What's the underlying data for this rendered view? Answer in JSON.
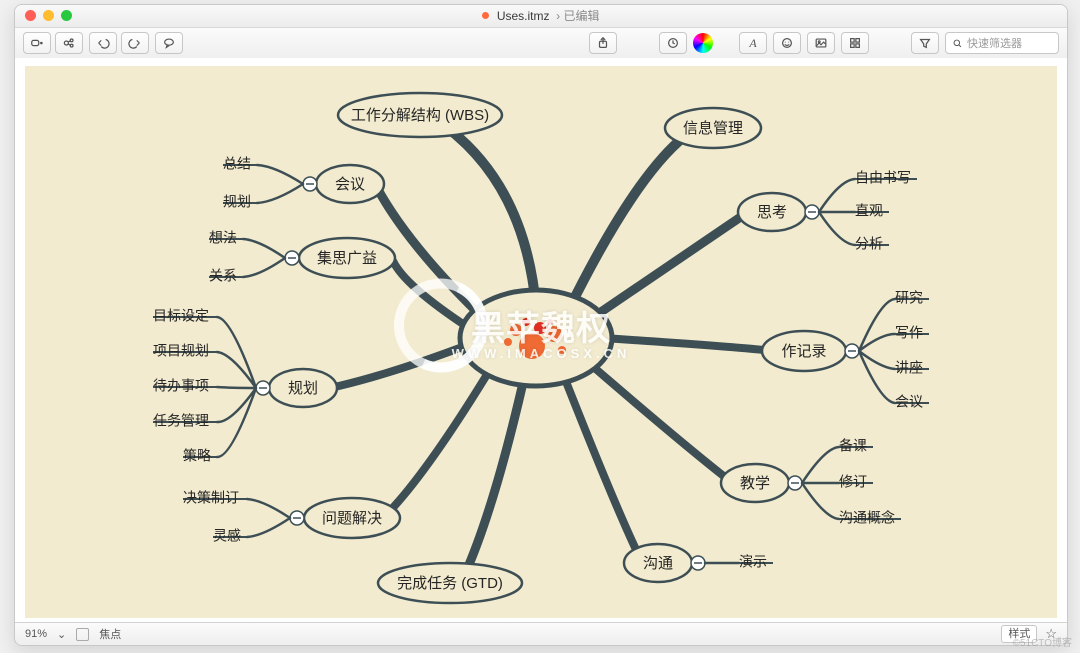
{
  "window": {
    "doc_icon": "●",
    "filename": "Uses.itmz",
    "state": "已编辑"
  },
  "toolbar": {
    "search_placeholder": "快速筛选器"
  },
  "nodes": {
    "n_wbs": "工作分解结构 (WBS)",
    "n_info": "信息管理",
    "n_meeting": "会议",
    "n_think": "思考",
    "n_brain": "集思广益",
    "n_record": "作记录",
    "n_plan": "规划",
    "n_teach": "教学",
    "n_problem": "问题解决",
    "n_comm": "沟通",
    "n_gtd": "完成任务 (GTD)"
  },
  "leaves": {
    "meeting_a": "总结",
    "meeting_b": "规划",
    "think_a": "自由书写",
    "think_b": "直观",
    "think_c": "分析",
    "brain_a": "想法",
    "brain_b": "关系",
    "record_a": "研究",
    "record_b": "写作",
    "record_c": "讲座",
    "record_d": "会议",
    "plan_a": "目标设定",
    "plan_b": "项目规划",
    "plan_c": "待办事项",
    "plan_d": "任务管理",
    "plan_e": "策略",
    "teach_a": "备课",
    "teach_b": "修订",
    "teach_c": "沟通概念",
    "problem_a": "决策制订",
    "problem_b": "灵感",
    "comm_a": "演示"
  },
  "status": {
    "zoom": "91%",
    "focus_label": "焦点",
    "style_label": "样式"
  },
  "watermark": {
    "main": "黑苹魏权",
    "sub": "WWW.IMACOSX.CN"
  },
  "corner": "©51CTO博客"
}
